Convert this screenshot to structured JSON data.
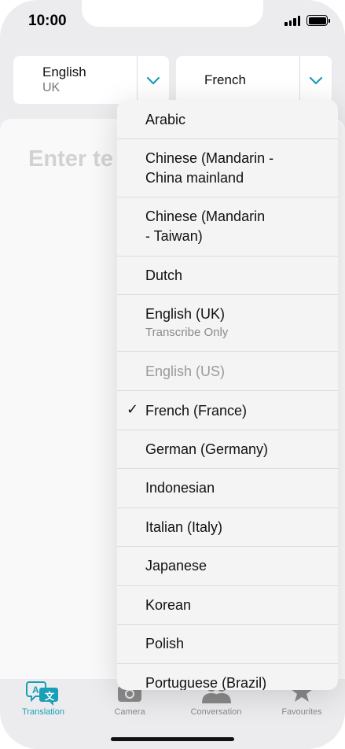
{
  "status": {
    "time": "10:00"
  },
  "languages": {
    "source": {
      "name": "English",
      "sub": "UK"
    },
    "target": {
      "name": "French"
    }
  },
  "input": {
    "placeholder": "Enter te"
  },
  "dropdown": {
    "items": [
      {
        "label": "Arabic"
      },
      {
        "label_line1": "Chinese (Mandarin -",
        "label_line2": "China mainland"
      },
      {
        "label_line1": "Chinese (Mandarin",
        "label_line2": "- Taiwan)"
      },
      {
        "label": "Dutch"
      },
      {
        "label": "English (UK)",
        "sub": "Transcribe Only"
      },
      {
        "label": "English (US)",
        "disabled": true
      },
      {
        "label": "French (France)",
        "selected": true,
        "check": "✓"
      },
      {
        "label": "German (Germany)"
      },
      {
        "label": "Indonesian"
      },
      {
        "label": "Italian (Italy)"
      },
      {
        "label": "Japanese"
      },
      {
        "label": "Korean"
      },
      {
        "label": "Polish"
      },
      {
        "label": "Portuguese (Brazil)"
      }
    ]
  },
  "tabs": [
    {
      "label": "Translation",
      "icon": "translate-icon",
      "active": true
    },
    {
      "label": "Camera",
      "icon": "camera-icon"
    },
    {
      "label": "Conversation",
      "icon": "conversation-icon"
    },
    {
      "label": "Favourites",
      "icon": "star-icon"
    }
  ],
  "colors": {
    "accent": "#1a9fb8",
    "background": "#ececef",
    "card": "#f9f9f9",
    "menu": "#f4f4f4"
  }
}
